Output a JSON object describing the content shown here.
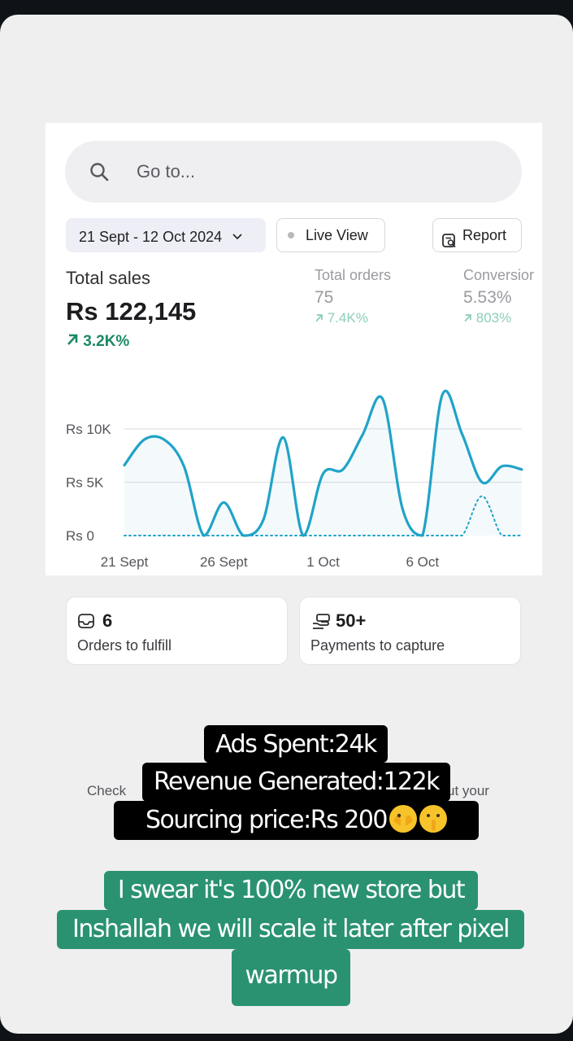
{
  "search": {
    "placeholder": "Go to..."
  },
  "toolbar": {
    "date_range": "21 Sept - 12 Oct 2024",
    "live_view": "Live View",
    "report": "Report"
  },
  "metrics": {
    "total_sales": {
      "label": "Total sales",
      "value": "Rs 122,145",
      "change": "3.2K%"
    },
    "total_orders": {
      "label": "Total orders",
      "value": "75",
      "change": "7.4K%"
    },
    "conversion": {
      "label": "Conversior",
      "value": "5.53%",
      "change": "803%"
    }
  },
  "chart_data": {
    "type": "line",
    "y_ticks": [
      "Rs 10K",
      "Rs 5K",
      "Rs 0"
    ],
    "x_ticks": [
      "21 Sept",
      "26 Sept",
      "1 Oct",
      "6 Oct"
    ],
    "ylim": [
      0,
      10000
    ],
    "series": [
      {
        "style": "solid",
        "color": "#21a3c8",
        "values": [
          6600,
          9000,
          9000,
          6500,
          0,
          3100,
          0,
          1500,
          9200,
          0,
          5800,
          6200,
          9500,
          12800,
          2500,
          0,
          13200,
          9500,
          5000,
          6500,
          6200
        ]
      },
      {
        "style": "dotted",
        "color": "#21a3c8",
        "values": [
          0,
          0,
          0,
          0,
          0,
          0,
          0,
          0,
          0,
          0,
          0,
          0,
          0,
          0,
          0,
          0,
          0,
          0,
          3700,
          0,
          0
        ]
      }
    ],
    "grid": true
  },
  "tiles": {
    "orders": {
      "value": "6",
      "label": "Orders to fulfill"
    },
    "payments": {
      "value": "50+",
      "label": "Payments to capture"
    }
  },
  "faded_text": {
    "left": "Check",
    "right": "ut your"
  },
  "overlay": {
    "line1": "Ads Spent:24k",
    "line2": "Revenue Generated:122k",
    "line3": "Sourcing price:Rs 200",
    "line4": "I swear it's 100% new store but",
    "line5": "Inshallah we will scale it later after pixel",
    "line6": "warmup"
  }
}
